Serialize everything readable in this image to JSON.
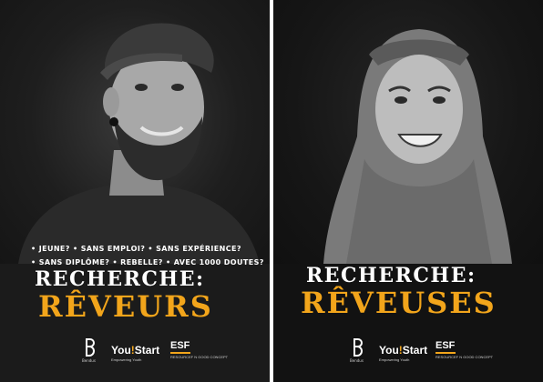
{
  "left_poster": {
    "bullets": [
      "• JEUNE?  • SANS EMPLOI?  • SANS EXPÉRIENCE?",
      "• SANS DIPLÔME? • REBELLE? • AVEC 1000 DOUTES?"
    ],
    "headline": "RECHERCHE:",
    "subheadline": "RÊVEURS",
    "logos": {
      "b_caption": "Bendus",
      "youstart": "You",
      "youstart_dot": "!",
      "youstart_tail": "Start",
      "youstart_sub": "Empowering Youth",
      "esf": "ESF",
      "esf_sub": "RESOURCEF N\nGOOD CONCEPT"
    }
  },
  "right_poster": {
    "headline": "RECHERCHE:",
    "subheadline": "RÊVEUSES",
    "logos": {
      "b_caption": "Bendus",
      "youstart": "You",
      "youstart_dot": "!",
      "youstart_tail": "Start",
      "youstart_sub": "Empowering Youth",
      "esf": "ESF",
      "esf_sub": "RESOURCEF N\nGOOD CONCEPT"
    }
  },
  "colors": {
    "accent": "#f2a51b",
    "background": "#141414",
    "text": "#ffffff"
  }
}
